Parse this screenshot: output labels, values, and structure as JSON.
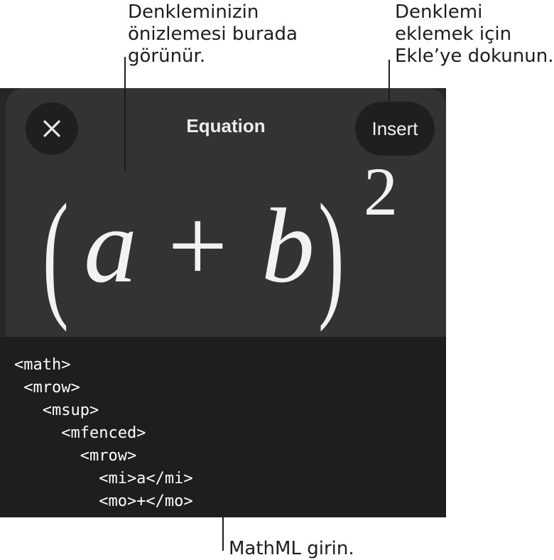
{
  "callouts": {
    "preview": [
      "Denkleminizin",
      "önizlemesi burada",
      "görünür."
    ],
    "insert": [
      "Denklemi",
      "eklemek için",
      "Ekle’ye dokunun."
    ],
    "mathml": "MathML girin."
  },
  "dialog": {
    "title": "Equation",
    "insert_label": "Insert",
    "close_icon": "x-icon"
  },
  "equation": {
    "open_paren": "(",
    "var_a": "a",
    "operator": "+",
    "var_b": "b",
    "close_paren": ")",
    "exponent": "2"
  },
  "mathml_editor": {
    "lines": [
      "<math>",
      " <mrow>",
      "   <msup>",
      "     <mfenced>",
      "       <mrow>",
      "         <mi>a</mi>",
      "         <mo>+</mo>"
    ]
  },
  "colors": {
    "panel": "#262628",
    "sheet": "#333335",
    "button": "#1f1f21",
    "editor": "#1e1e1e"
  }
}
